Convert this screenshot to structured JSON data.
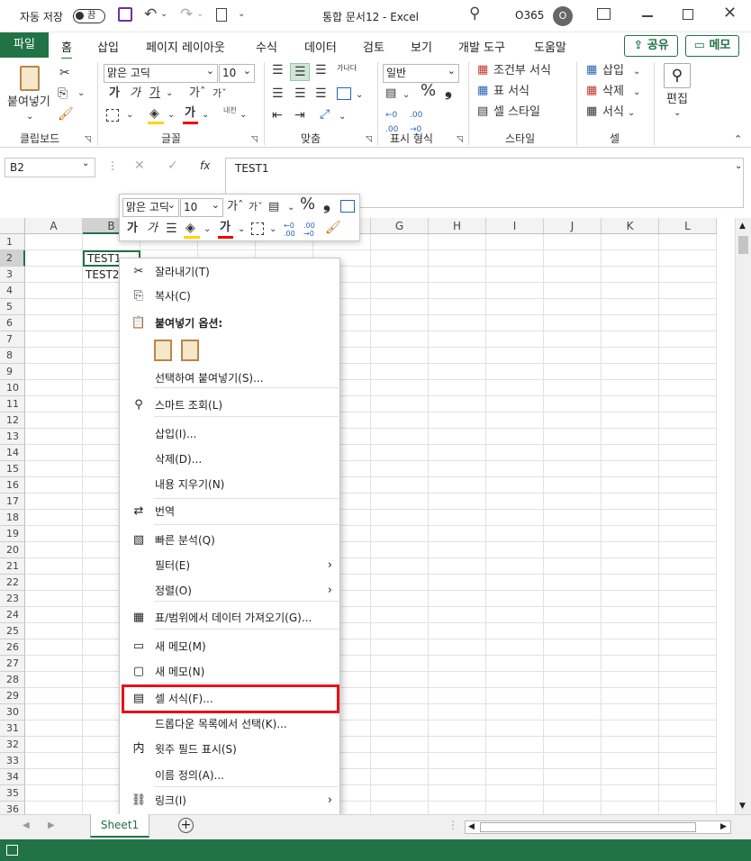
{
  "titlebar": {
    "autosave_label": "자동 저장",
    "autosave_state": "끔",
    "doc_title": "통합 문서12  -  Excel",
    "account": "O365",
    "avatar_letter": "O"
  },
  "tabs": [
    "홈",
    "삽입",
    "페이지 레이아웃",
    "수식",
    "데이터",
    "검토",
    "보기",
    "개발 도구",
    "도움말"
  ],
  "file_tab": "파일",
  "share_label": "공유",
  "memo_label": "메모",
  "ribbon": {
    "clipboard": {
      "paste": "붙여넣기",
      "label": "클립보드"
    },
    "font": {
      "name": "맑은 고딕",
      "size": "10",
      "label": "글꼴",
      "bold": "가",
      "italic": "가",
      "underline": "가",
      "grow": "가ˆ",
      "shrink": "가ˇ",
      "phonetic": "내천",
      "fontcolor": "가"
    },
    "align": {
      "label": "맞춤",
      "wrap": "가나다"
    },
    "number": {
      "format": "일반",
      "label": "표시 형식",
      "percent": "%",
      "comma": "❟",
      "inc": "←.0\n.00",
      "dec": ".00\n→.0"
    },
    "styles": {
      "cond": "조건부 서식",
      "table": "표 서식",
      "cell": "셀 스타일",
      "label": "스타일"
    },
    "cells": {
      "insert": "삽입",
      "delete": "삭제",
      "format": "서식",
      "label": "셀"
    },
    "editing": {
      "label": "편집"
    }
  },
  "namebox": "B2",
  "formula": "TEST1",
  "formula_icons": {
    "cancel": "✕",
    "enter": "✓",
    "fx": "fx"
  },
  "columns": [
    "A",
    "B",
    "C",
    "D",
    "E",
    "F",
    "G",
    "H",
    "I",
    "J",
    "K",
    "L"
  ],
  "rows": [
    "1",
    "2",
    "3",
    "4",
    "5",
    "6",
    "7",
    "8",
    "9",
    "10",
    "11",
    "12",
    "13",
    "14",
    "15",
    "16",
    "17",
    "18",
    "19",
    "20",
    "21",
    "22",
    "23",
    "24",
    "25",
    "26",
    "27",
    "28",
    "29",
    "30",
    "31",
    "32",
    "33",
    "34",
    "35",
    "36"
  ],
  "cells": {
    "B2": "TEST1",
    "B3": "TEST2"
  },
  "minitoolbar": {
    "font": "맑은 고딕",
    "size": "10",
    "grow": "가ˆ",
    "shrink": "가ˇ",
    "percent": "%",
    "comma": "❟",
    "bold": "가",
    "italic": "가",
    "fontcolor": "가"
  },
  "context_menu": [
    {
      "icon": "scissors-icon",
      "label": "잘라내기(T)"
    },
    {
      "icon": "copy-icon",
      "label": "복사(C)"
    },
    {
      "icon": "paste-icon",
      "label": "붙여넣기 옵션:",
      "bold": true
    },
    {
      "icon": "",
      "label": ""
    },
    {
      "icon": "",
      "label": "선택하여 붙여넣기(S)..."
    },
    {
      "icon": "smart-lookup-icon",
      "label": "스마트 조회(L)"
    },
    {
      "icon": "",
      "label": "삽입(I)..."
    },
    {
      "icon": "",
      "label": "삭제(D)..."
    },
    {
      "icon": "",
      "label": "내용 지우기(N)"
    },
    {
      "icon": "translate-icon",
      "label": "번역"
    },
    {
      "icon": "quick-analysis-icon",
      "label": "빠른 분석(Q)"
    },
    {
      "icon": "",
      "label": "필터(E)",
      "submenu": true
    },
    {
      "icon": "",
      "label": "정렬(O)",
      "submenu": true
    },
    {
      "icon": "table-icon",
      "label": "표/범위에서 데이터 가져오기(G)..."
    },
    {
      "icon": "new-comment-icon",
      "label": "새 메모(M)"
    },
    {
      "icon": "new-note-icon",
      "label": "새 메모(N)"
    },
    {
      "icon": "format-cells-icon",
      "label": "셀 서식(F)..."
    },
    {
      "icon": "",
      "label": "드롭다운 목록에서 선택(K)..."
    },
    {
      "icon": "phonetic-icon",
      "label": "윗주 필드 표시(S)"
    },
    {
      "icon": "",
      "label": "이름 정의(A)..."
    },
    {
      "icon": "link-icon",
      "label": "링크(I)",
      "submenu": true
    }
  ],
  "sheet_tab": "Sheet1",
  "highlight_color": "#e8101a",
  "accent_color": "#217346"
}
